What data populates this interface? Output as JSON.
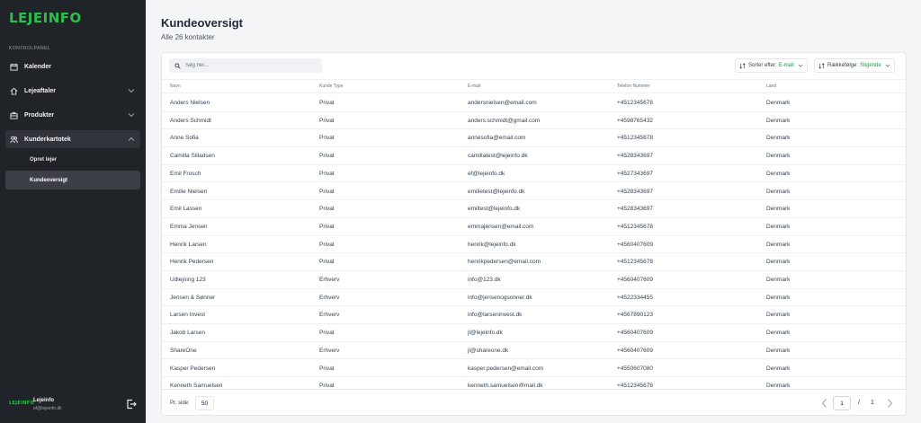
{
  "app": {
    "logo": "LEJEINFO"
  },
  "sidebar": {
    "section_label": "KONTROLPANEL",
    "items": [
      {
        "label": "Kalender",
        "icon": "calendar-icon"
      },
      {
        "label": "Lejeaftaler",
        "icon": "home-icon"
      },
      {
        "label": "Produkter",
        "icon": "briefcase-icon"
      },
      {
        "label": "Kunderkartotek",
        "icon": "users-icon"
      }
    ],
    "subitems": [
      {
        "label": "Opret lejer"
      },
      {
        "label": "Kundeoversigt"
      }
    ],
    "footer": {
      "logo": "LEJEINFO",
      "name": "Lejeinfo",
      "email": "ef@lejeinfo.dk"
    }
  },
  "page": {
    "title": "Kundeoversigt",
    "subtitle": "Alle 26 kontakter"
  },
  "search": {
    "placeholder": "Søg her..."
  },
  "controls": {
    "sort_label": "Sorter efter:",
    "sort_value": "E-mail",
    "order_label": "Rækkefølge:",
    "order_value": "Stigende"
  },
  "table": {
    "headers": [
      "Navn",
      "Kunde Type",
      "E-mail",
      "Telefon Nummer",
      "Land"
    ],
    "rows": [
      [
        "Anders Nielsen",
        "Privat",
        "andersnielsen@email.com",
        "+4512345678",
        "Denmark"
      ],
      [
        "Anders Schmidt",
        "Privat",
        "anders.schmidt@gmail.com",
        "+4598765432",
        "Denmark"
      ],
      [
        "Anne Sofia",
        "Privat",
        "annesofia@email.com",
        "+4512345678",
        "Denmark"
      ],
      [
        "Camilla Silladsen",
        "Privat",
        "camillatest@lejeinfo.dk",
        "+4528343697",
        "Denmark"
      ],
      [
        "Emil Frosch",
        "Privat",
        "ef@lejeinfo.dk",
        "+4527343697",
        "Denmark"
      ],
      [
        "Emilie Nielsen",
        "Privat",
        "emilietest@lejeinfo.dk",
        "+4528343697",
        "Denmark"
      ],
      [
        "Emil Lassen",
        "Privat",
        "emiltest@lejeinfo.dk",
        "+4528343697",
        "Denmark"
      ],
      [
        "Emma Jensen",
        "Privat",
        "emmajensen@email.com",
        "+4512345678",
        "Denmark"
      ],
      [
        "Henrik Larsen",
        "Privat",
        "henrik@lejeinfo.dk",
        "+4560407609",
        "Denmark"
      ],
      [
        "Henrik Pedersen",
        "Privat",
        "henrikpedersen@email.com",
        "+4512345678",
        "Denmark"
      ],
      [
        "Udlejning 123",
        "Erhverv",
        "info@123.dk",
        "+4560407609",
        "Denmark"
      ],
      [
        "Jensen & Sønner",
        "Erhverv",
        "info@jensenogsonner.dk",
        "+4522334455",
        "Denmark"
      ],
      [
        "Larsen Invest",
        "Erhverv",
        "info@larseninvest.dk",
        "+4567890123",
        "Denmark"
      ],
      [
        "Jakob Larsen",
        "Privat",
        "jl@lejeinfo.dk",
        "+4560407609",
        "Denmark"
      ],
      [
        "ShareOne",
        "Erhverv",
        "jl@shareone.dk",
        "+4560407609",
        "Denmark"
      ],
      [
        "Kasper Pedersen",
        "Privat",
        "kasper.pedersen@email.com",
        "+4550607080",
        "Denmark"
      ],
      [
        "Kenneth Samuelsen",
        "Privat",
        "kenneth.samuelsen@mail.dk",
        "+4512345678",
        "Denmark"
      ]
    ]
  },
  "pagination": {
    "per_page_label": "Pr. side:",
    "per_page_value": "50",
    "current": "1",
    "separator": "/",
    "total": "1"
  },
  "colors": {
    "accent": "#2dbf4e",
    "sidebar_bg": "#202327",
    "link_green": "#16a34a"
  }
}
